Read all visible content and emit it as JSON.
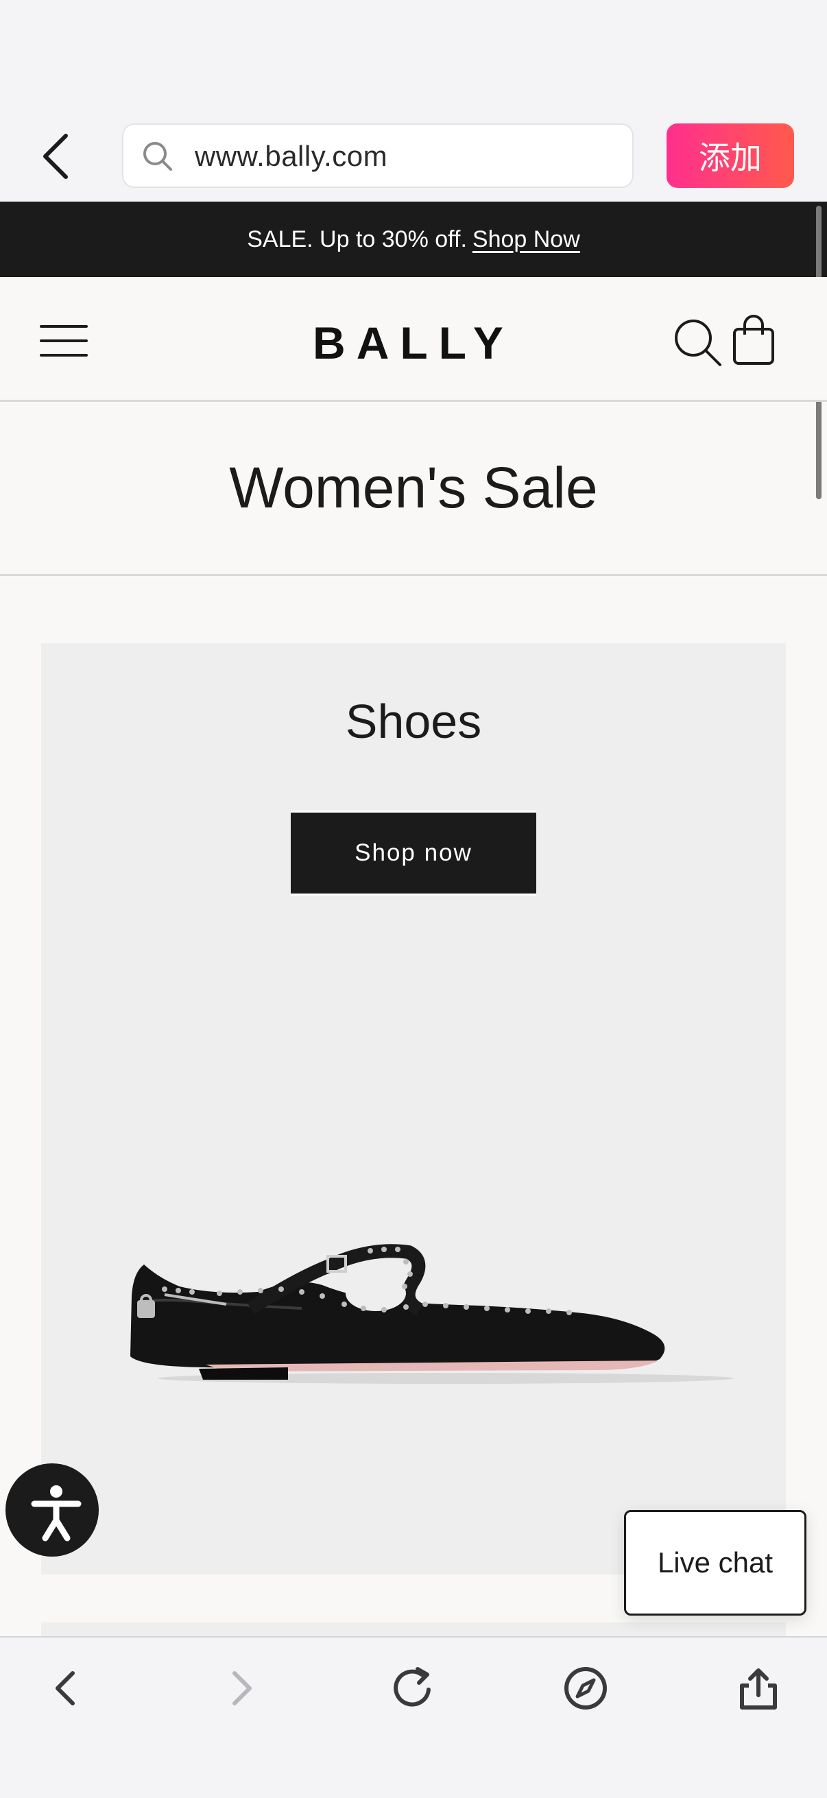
{
  "browser": {
    "url": "www.bally.com",
    "add_label": "添加"
  },
  "promo": {
    "text": "SALE. Up to 30% off.",
    "link": "Shop Now"
  },
  "header": {
    "logo": "BALLY"
  },
  "page": {
    "title": "Women's Sale"
  },
  "card": {
    "title": "Shoes",
    "button": "Shop now"
  },
  "chat": {
    "label": "Live chat"
  },
  "colors": {
    "promo_bg": "#1b1b1b",
    "add_gradient_start": "#ff2f8e",
    "add_gradient_end": "#ff5a4c",
    "card_bg": "#eeeeee"
  },
  "icons": {
    "browser_back": "chevron-left-icon",
    "search": "search-icon",
    "menu": "hamburger-icon",
    "cart": "shopping-bag-icon",
    "accessibility": "accessibility-icon",
    "toolbar": [
      "back-icon",
      "forward-icon",
      "reload-icon",
      "compass-icon",
      "share-icon"
    ]
  }
}
